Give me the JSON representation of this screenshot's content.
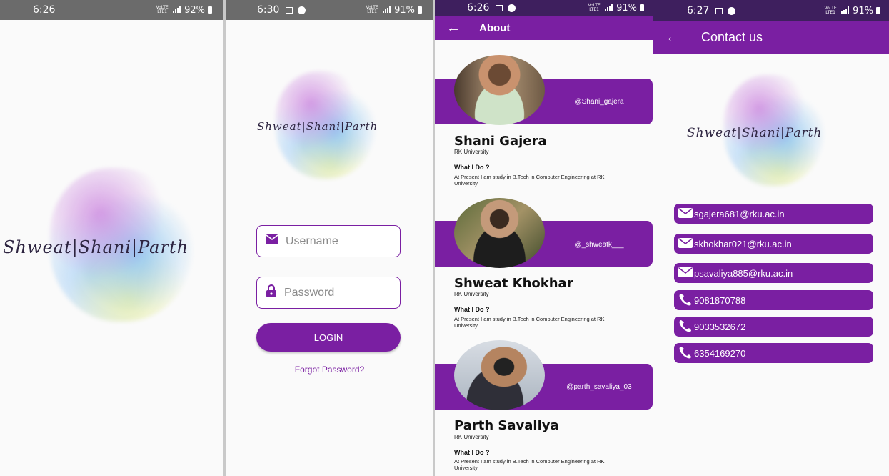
{
  "screens": {
    "splash": {
      "status_time": "6:26",
      "status_battery": "92%",
      "status_network": "VoLTE LTE1",
      "logo_text": "Shweat|Shani|Parth"
    },
    "login": {
      "status_time": "6:30",
      "status_battery": "91%",
      "status_network": "VoLTE LTE1",
      "logo_text": "Shweat|Shani|Parth",
      "username_placeholder": "Username",
      "password_placeholder": "Password",
      "login_label": "LOGIN",
      "forgot_label": "Forgot Password?"
    },
    "about": {
      "status_time": "6:26",
      "status_battery": "91%",
      "status_network": "VoLTE LTE1",
      "title": "About",
      "members": [
        {
          "handle": "@Shani_gajera",
          "name": "Shani Gajera",
          "university": "RK University",
          "question": "What I Do ?",
          "description": "At Present I am study in B.Tech in Computer Engineering at RK University."
        },
        {
          "handle": "@_shweatk___",
          "name": "Shweat Khokhar",
          "university": "RK University",
          "question": "What I Do ?",
          "description": "At Present I am study in B.Tech in Computer Engineering at RK University."
        },
        {
          "handle": "@parth_savaliya_03",
          "name": "Parth Savaliya",
          "university": "RK University",
          "question": "What I Do ?",
          "description": "At Present I am study in B.Tech in Computer Engineering at RK University."
        }
      ]
    },
    "contact": {
      "status_time": "6:27",
      "status_battery": "91%",
      "status_network": "VoLTE LTE1",
      "title": "Contact us",
      "logo_text": "Shweat|Shani|Parth",
      "items": [
        {
          "type": "email",
          "icon": "mail-icon",
          "value": "sgajera681@rku.ac.in"
        },
        {
          "type": "email",
          "icon": "mail-icon",
          "value": "skhokhar021@rku.ac.in"
        },
        {
          "type": "email",
          "icon": "mail-icon",
          "value": "psavaliya885@rku.ac.in"
        },
        {
          "type": "phone",
          "icon": "phone-icon",
          "value": "9081870788"
        },
        {
          "type": "phone",
          "icon": "phone-icon",
          "value": "9033532672"
        },
        {
          "type": "phone",
          "icon": "phone-icon",
          "value": "6354169270"
        }
      ]
    }
  },
  "colors": {
    "primary": "#7a1fa2",
    "status_dark": "#3e1f5e",
    "status_grey": "#6b6b6b",
    "background": "#fafafa"
  }
}
